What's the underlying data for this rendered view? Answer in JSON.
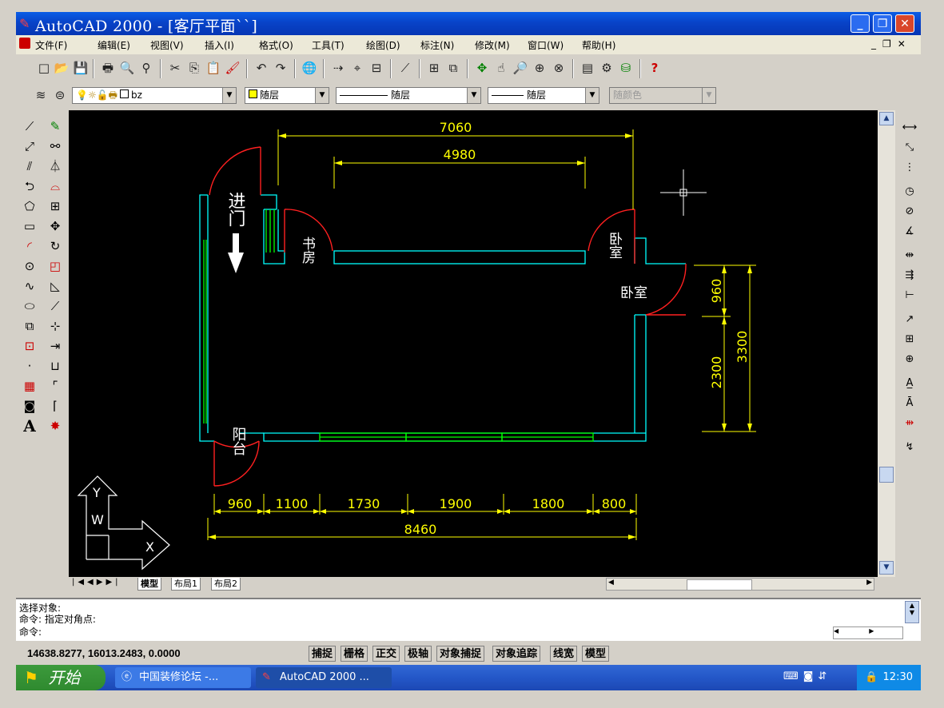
{
  "window": {
    "title": "AutoCAD 2000 - [客厅平面``]"
  },
  "menu": [
    "文件(F)",
    "编辑(E)",
    "视图(V)",
    "插入(I)",
    "格式(O)",
    "工具(T)",
    "绘图(D)",
    "标注(N)",
    "修改(M)",
    "窗口(W)",
    "帮助(H)"
  ],
  "layers": {
    "layer_name": "bz",
    "color": "随层",
    "linetype": "随层",
    "lineweight": "随层",
    "plotstyle": "随颜色"
  },
  "drawing": {
    "dims_top": [
      "7060",
      "4980"
    ],
    "dims_right": [
      "960",
      "2300",
      "3300"
    ],
    "dims_bottom": [
      "960",
      "1100",
      "1730",
      "1900",
      "1800",
      "800"
    ],
    "dim_total": "8460",
    "labels": {
      "enter": "进门",
      "study": "书房",
      "bedroom1": "卧室",
      "bedroom2": "卧室",
      "balcony": "阳台"
    },
    "ucs": {
      "y": "Y",
      "w": "W",
      "x": "X"
    }
  },
  "tabs": [
    "模型",
    "布局1",
    "布局2"
  ],
  "command": {
    "line1": "选择对象:",
    "line2": "命令: 指定对角点:",
    "line3": "命令:"
  },
  "status": {
    "coords": "14638.8277, 16013.2483, 0.0000",
    "buttons": [
      "捕捉",
      "栅格",
      "正交",
      "极轴",
      "对象捕捉",
      "对象追踪",
      "线宽",
      "模型"
    ]
  },
  "taskbar": {
    "start": "开始",
    "task1": "中国装修论坛 -...",
    "task2": "AutoCAD 2000 ...",
    "time": "12:30"
  },
  "colors": {
    "wall": "#00ffff",
    "door": "#ff0000",
    "dim": "#ffff00",
    "window": "#00ff00",
    "text": "#ffffff"
  }
}
